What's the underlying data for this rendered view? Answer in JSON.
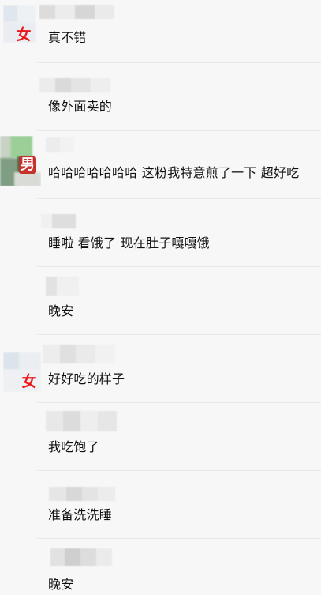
{
  "comments": [
    {
      "text": "真不错"
    },
    {
      "text": "像外面卖的"
    },
    {
      "text": "哈哈哈哈哈哈哈 这粉我特意煎了一下 超好吃"
    },
    {
      "text": "睡啦 看饿了 现在肚子嘎嘎饿"
    },
    {
      "text": "晚安"
    },
    {
      "text": "好好吃的样子"
    },
    {
      "text": "我吃饱了"
    },
    {
      "text": "准备洗洗睡"
    },
    {
      "text": "晚安"
    }
  ],
  "badges": {
    "female_1": "女",
    "male_1": "男",
    "female_2": "女"
  },
  "colors": {
    "female_badge": "#e8181b",
    "male_badge_bg": "#c8302c",
    "divider": "#e8e8e8",
    "background": "#f7f7f7"
  }
}
